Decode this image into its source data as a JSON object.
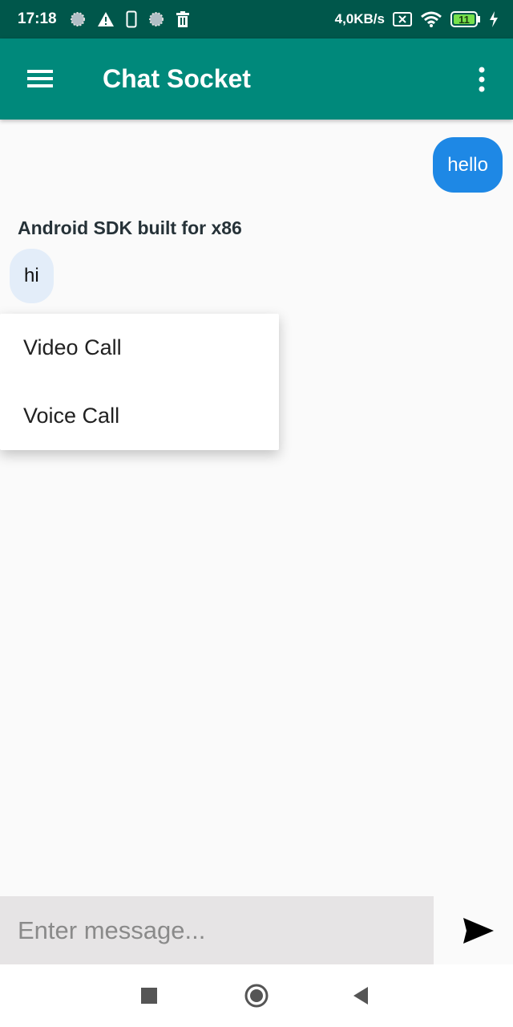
{
  "statusbar": {
    "time": "17:18",
    "speed": "4,0KB/s",
    "battery": "11",
    "icons": [
      "sync-icon",
      "warning-icon",
      "phone-icon",
      "sync-icon",
      "trash-icon",
      "sim-x-icon",
      "wifi-icon",
      "battery-icon",
      "charging-icon"
    ]
  },
  "appbar": {
    "title": "Chat Socket"
  },
  "messages": [
    {
      "direction": "outgoing",
      "text": "hello"
    },
    {
      "direction": "incoming",
      "sender": "Android SDK built for x86",
      "text": "hi"
    }
  ],
  "popup_menu": {
    "items": [
      {
        "label": "Video Call"
      },
      {
        "label": "Voice Call"
      }
    ]
  },
  "composer": {
    "value": "",
    "placeholder": "Enter message..."
  },
  "colors": {
    "statusbar": "#00574b",
    "appbar": "#00897b",
    "outgoing_bubble": "#1e88e5",
    "incoming_bubble": "#e3edf9",
    "composer_bg": "#e6e4e5"
  }
}
